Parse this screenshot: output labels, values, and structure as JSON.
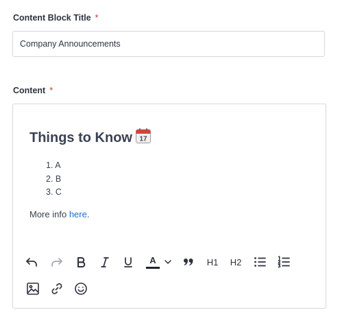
{
  "form": {
    "title_label": "Content Block Title",
    "required_mark": "*",
    "title_value": "Company Announcements",
    "content_label": "Content"
  },
  "editor": {
    "heading": "Things to Know",
    "heading_emoji": "calendar-icon",
    "calendar_day": "17",
    "list": [
      {
        "num": "1.",
        "text": "A"
      },
      {
        "num": "2.",
        "text": "B"
      },
      {
        "num": "3.",
        "text": "C"
      }
    ],
    "more_prefix": "More info ",
    "more_link": "here",
    "more_suffix": "."
  },
  "toolbar": {
    "h1": "H1",
    "h2": "H2",
    "text_color_letter": "A",
    "icons": [
      "undo-icon",
      "redo-icon",
      "bold-icon",
      "italic-icon",
      "underline-icon",
      "text-color-icon",
      "chevron-down-icon",
      "quote-icon",
      "bullet-list-icon",
      "numbered-list-icon",
      "image-icon",
      "link-icon",
      "emoji-icon"
    ]
  },
  "colors": {
    "required": "#d0322b",
    "link": "#1a6fd6",
    "text_color_swatch": "#1f2430",
    "border": "#d4d7de"
  }
}
